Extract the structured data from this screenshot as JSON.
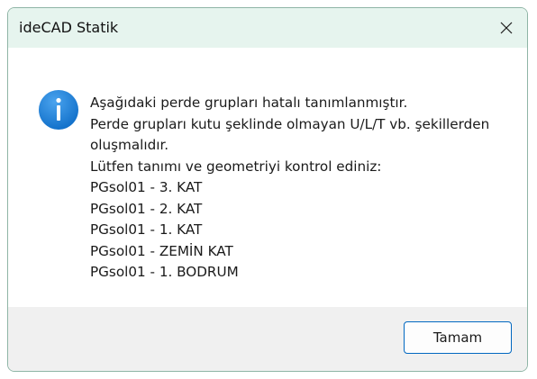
{
  "window": {
    "title": "ideCAD Statik",
    "close_icon": "close-icon"
  },
  "message": {
    "icon": "info-icon",
    "lines": [
      "Aşağıdaki perde grupları hatalı tanımlanmıştır.",
      "Perde grupları kutu şeklinde olmayan U/L/T vb. şekillerden",
      "oluşmalıdır.",
      "Lütfen tanımı ve geometriyi kontrol ediniz:",
      "PGsol01 - 3. KAT",
      "PGsol01 - 2. KAT",
      "PGsol01 - 1. KAT",
      "PGsol01 - ZEMİN KAT",
      "PGsol01 - 1. BODRUM"
    ]
  },
  "footer": {
    "ok_label": "Tamam"
  },
  "colors": {
    "titlebar_bg": "#e6f4ee",
    "footer_bg": "#f0f0f0",
    "accent": "#0067c0",
    "info_icon": "#1a7fd4"
  }
}
